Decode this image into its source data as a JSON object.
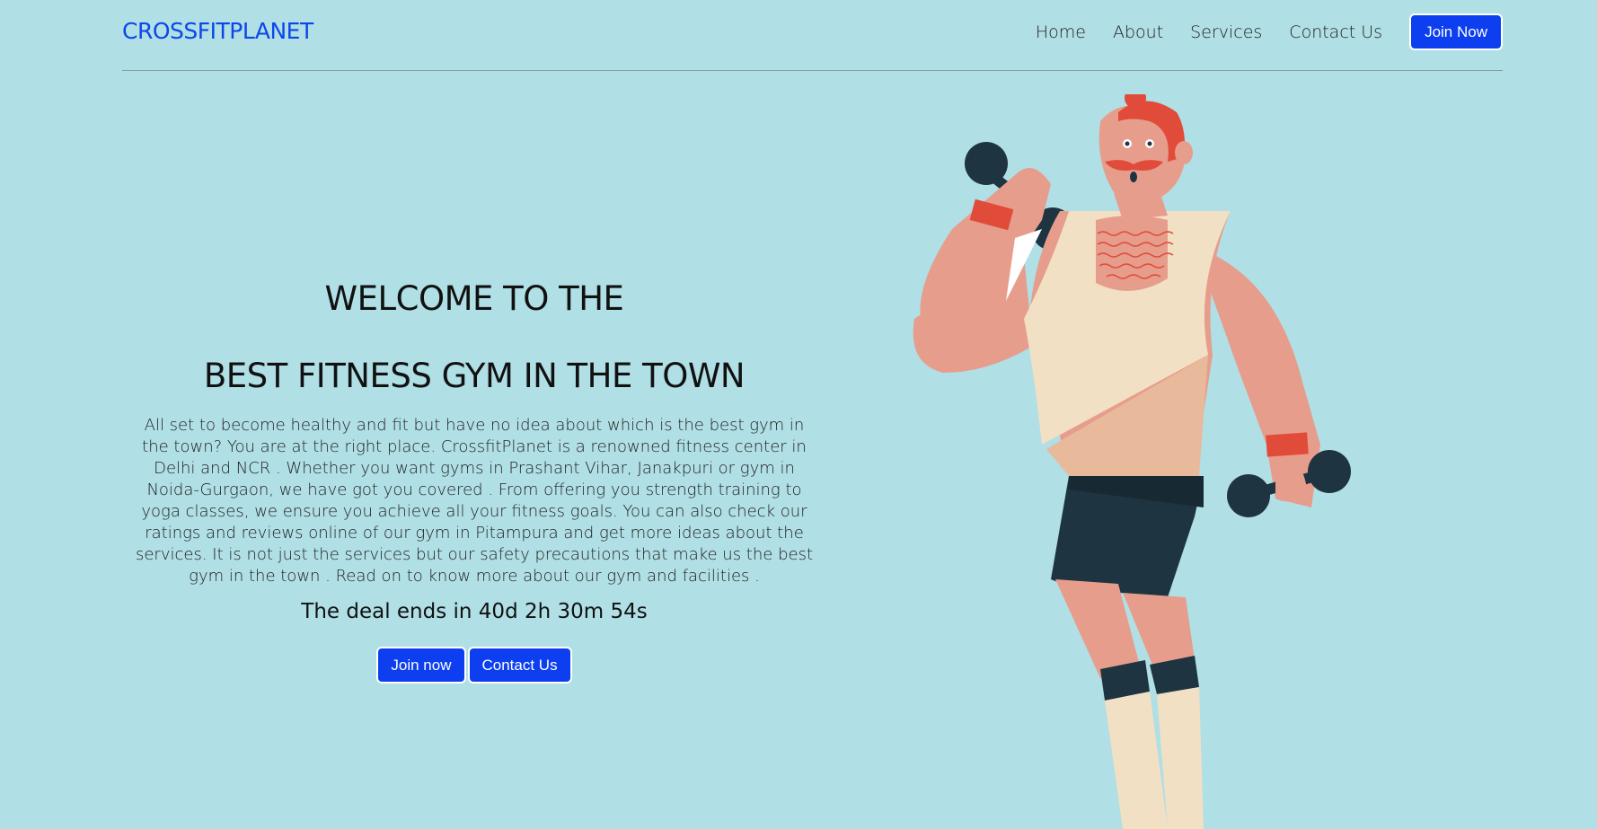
{
  "header": {
    "brand": "CROSSFITPLANET",
    "nav": [
      "Home",
      "About",
      "Services",
      "Contact Us"
    ],
    "join_button": "Join Now"
  },
  "hero": {
    "title_line1": "WELCOME TO THE",
    "title_line2": "BEST FITNESS GYM IN THE TOWN",
    "description": "All set to become healthy and fit but have no idea about which is the best gym in the town? You are at the right place. CrossfitPlanet is a renowned fitness center in Delhi and NCR . Whether you want gyms in Prashant Vihar, Janakpuri or gym in Noida-Gurgaon, we have got you covered . From offering you strength training to yoga classes, we ensure you achieve all your fitness goals. You can also check our ratings and reviews online of our gym in Pitampura and get more ideas about the services. It is not just the services but our safety precautions that make us the best gym in the town . Read on to know more about our gym and facilities .",
    "deal_text": "The deal ends in 40d 2h 30m 54s",
    "join_button": "Join now",
    "contact_button": "Contact Us"
  },
  "colors": {
    "background": "#b0dfe5",
    "accent": "#0d3ff0",
    "brand": "#0d47e8"
  },
  "illustration": {
    "icon": "gym-man-dumbbells-illustration"
  }
}
